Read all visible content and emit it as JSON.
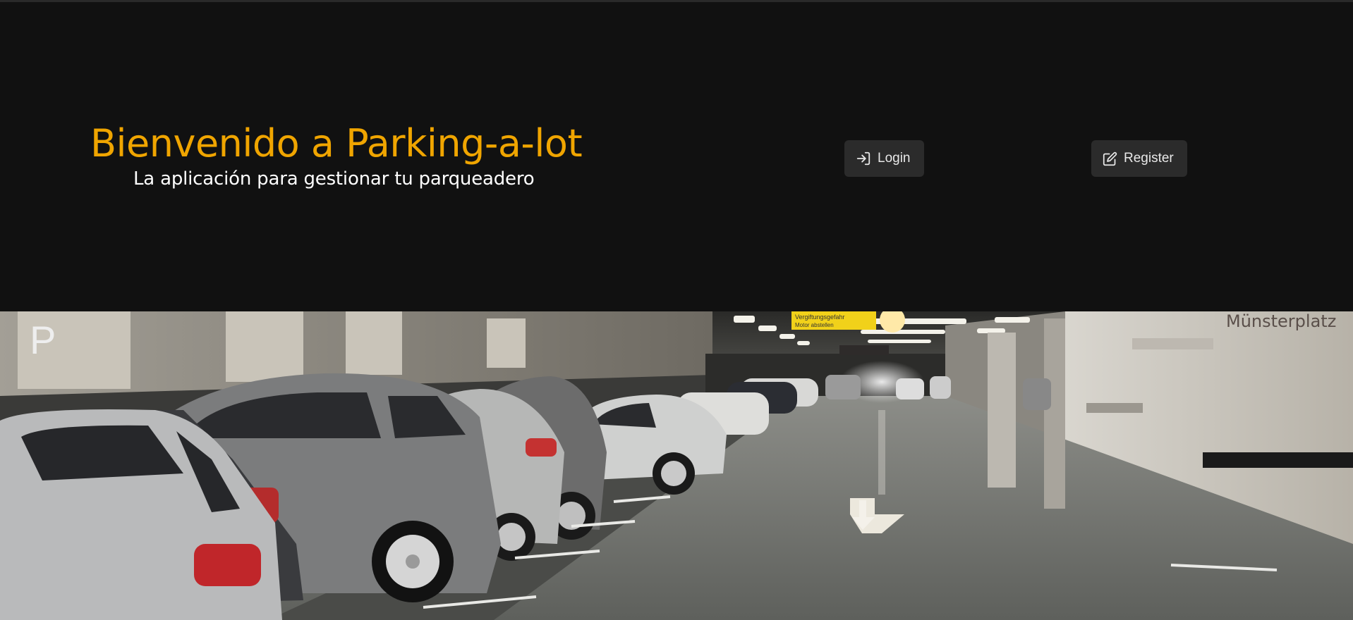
{
  "hero": {
    "title": "Bienvenido a Parking-a-lot",
    "subtitle": "La aplicación para gestionar tu parqueadero"
  },
  "nav": {
    "login_label": "Login",
    "register_label": "Register"
  },
  "photo": {
    "sign_p": "P",
    "sign_munster": "Münsterplatz",
    "sign_warning": "Vergiftungsgefahr",
    "sign_warning_2": "Motor abstellen"
  },
  "colors": {
    "accent": "#f0a500",
    "background": "#111111",
    "button_bg": "#2b2b2b",
    "button_text": "#e8e8e8"
  },
  "icons": {
    "login": "login-arrow-icon",
    "register": "edit-pencil-icon"
  }
}
